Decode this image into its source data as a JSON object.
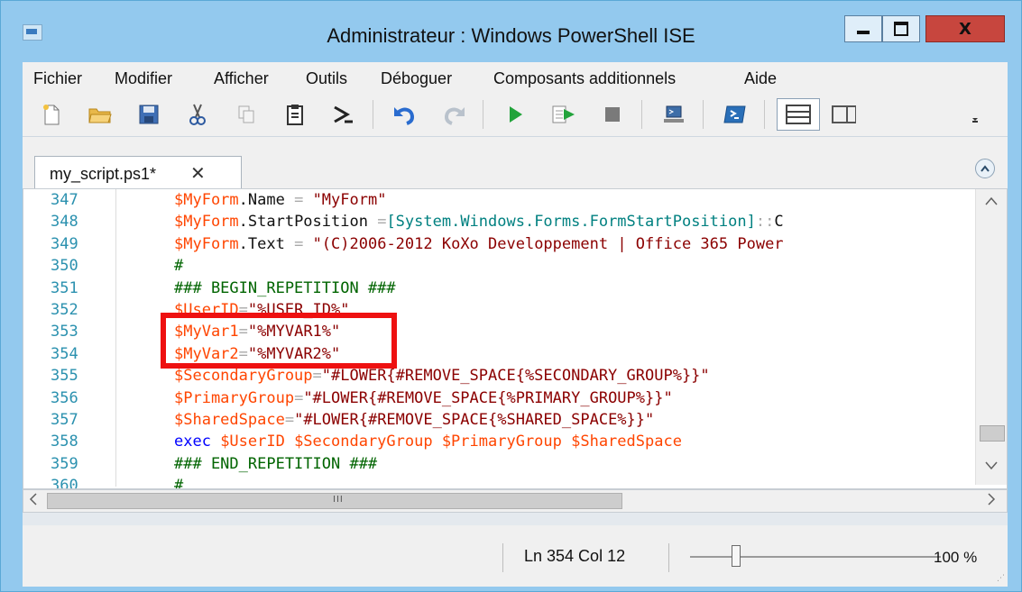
{
  "window": {
    "title": "Administrateur : Windows PowerShell ISE",
    "close_glyph": "X"
  },
  "menu": [
    "Fichier",
    "Modifier",
    "Afficher",
    "Outils",
    "Déboguer",
    "Composants additionnels",
    "Aide"
  ],
  "toolbar_icons": [
    "new-file-icon",
    "open-folder-icon",
    "save-icon",
    "cut-icon",
    "copy-icon",
    "paste-icon",
    "powershell-prompt-icon",
    "undo-icon",
    "redo-icon",
    "run-script-icon",
    "run-selection-icon",
    "stop-icon",
    "remote-powershell-icon",
    "powershell-console-icon",
    "show-script-pane-top-icon",
    "show-script-pane-right-icon"
  ],
  "tab": {
    "label": "my_script.ps1*",
    "close_glyph": "✕"
  },
  "editor": {
    "lines": [
      {
        "num": "347",
        "tokens": [
          [
            "var",
            "$MyForm"
          ],
          [
            "prop",
            ".Name "
          ],
          [
            "op",
            "= "
          ],
          [
            "str",
            "\"MyForm\""
          ]
        ]
      },
      {
        "num": "348",
        "tokens": [
          [
            "var",
            "$MyForm"
          ],
          [
            "prop",
            ".StartPosition "
          ],
          [
            "op",
            "="
          ],
          [
            "type",
            "[System.Windows.Forms.FormStartPosition]"
          ],
          [
            "op",
            "::"
          ],
          [
            "prop",
            "C"
          ]
        ]
      },
      {
        "num": "349",
        "tokens": [
          [
            "var",
            "$MyForm"
          ],
          [
            "prop",
            ".Text "
          ],
          [
            "op",
            "= "
          ],
          [
            "str",
            "\"(C)2006-2012 KoXo Developpement | Office 365 Power"
          ]
        ]
      },
      {
        "num": "350",
        "tokens": [
          [
            "cmt",
            "#"
          ]
        ]
      },
      {
        "num": "351",
        "tokens": [
          [
            "cmt",
            "### BEGIN_REPETITION ###"
          ]
        ]
      },
      {
        "num": "352",
        "tokens": [
          [
            "var",
            "$UserID"
          ],
          [
            "op",
            "="
          ],
          [
            "str",
            "\"%USER_ID%\""
          ]
        ]
      },
      {
        "num": "353",
        "tokens": [
          [
            "var",
            "$MyVar1"
          ],
          [
            "op",
            "="
          ],
          [
            "str",
            "\"%MYVAR1%\""
          ]
        ]
      },
      {
        "num": "354",
        "tokens": [
          [
            "var",
            "$MyVar2"
          ],
          [
            "op",
            "="
          ],
          [
            "str",
            "\"%MYVAR2%\""
          ]
        ]
      },
      {
        "num": "355",
        "tokens": [
          [
            "var",
            "$SecondaryGroup"
          ],
          [
            "op",
            "="
          ],
          [
            "str",
            "\"#LOWER{#REMOVE_SPACE{%SECONDARY_GROUP%}}\""
          ]
        ]
      },
      {
        "num": "356",
        "tokens": [
          [
            "var",
            "$PrimaryGroup"
          ],
          [
            "op",
            "="
          ],
          [
            "str",
            "\"#LOWER{#REMOVE_SPACE{%PRIMARY_GROUP%}}\""
          ]
        ]
      },
      {
        "num": "357",
        "tokens": [
          [
            "var",
            "$SharedSpace"
          ],
          [
            "op",
            "="
          ],
          [
            "str",
            "\"#LOWER{#REMOVE_SPACE{%SHARED_SPACE%}}\""
          ]
        ]
      },
      {
        "num": "358",
        "tokens": [
          [
            "cmd",
            "exec "
          ],
          [
            "var",
            "$UserID $SecondaryGroup $PrimaryGroup $SharedSpace"
          ]
        ]
      },
      {
        "num": "359",
        "tokens": [
          [
            "cmt",
            "### END_REPETITION ###"
          ]
        ]
      },
      {
        "num": "360",
        "tokens": [
          [
            "cmt",
            "#"
          ]
        ]
      }
    ]
  },
  "hscroll": {
    "grip": "III"
  },
  "status": {
    "position": "Ln 354  Col 12",
    "zoom": "100 %"
  },
  "colors": {
    "variable": "#ff4500",
    "string": "#8b0000",
    "comment": "#006400",
    "command": "#0000ff",
    "type": "#008080",
    "line_number": "#2b91af",
    "highlight": "#ee1111"
  }
}
